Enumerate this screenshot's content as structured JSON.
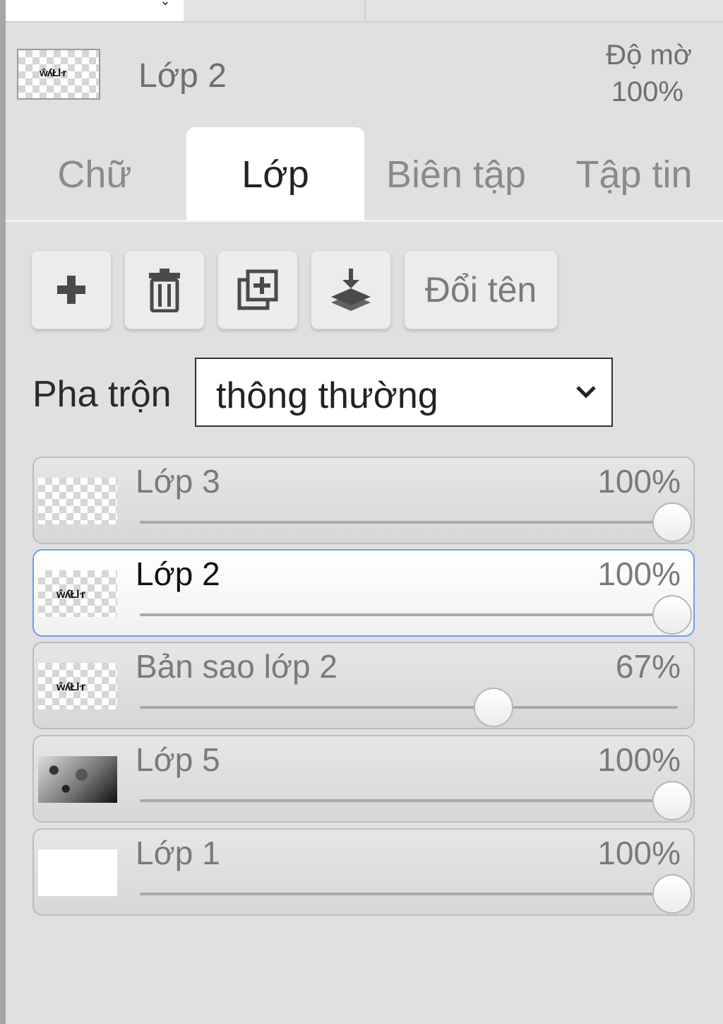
{
  "current_layer": {
    "name": "Lớp 2",
    "opacity_label": "Độ mờ",
    "opacity_value": "100%"
  },
  "tabs": [
    {
      "label": "Chữ",
      "active": false
    },
    {
      "label": "Lớp",
      "active": true
    },
    {
      "label": "Biên tập",
      "active": false
    },
    {
      "label": "Tập tin",
      "active": false
    }
  ],
  "toolbar": {
    "add_icon": "plus-icon",
    "delete_icon": "trash-icon",
    "duplicate_icon": "duplicate-icon",
    "merge_icon": "merge-down-icon",
    "rename_label": "Đổi tên"
  },
  "blend": {
    "label": "Pha trộn",
    "value": "thông thường"
  },
  "layers": [
    {
      "name": "Lớp 3",
      "opacity": "100%",
      "opacity_fraction": 1.0,
      "selected": false,
      "thumb": "transparent"
    },
    {
      "name": "Lớp 2",
      "opacity": "100%",
      "opacity_fraction": 1.0,
      "selected": true,
      "thumb": "scribble"
    },
    {
      "name": "Bản sao lớp 2",
      "opacity": "67%",
      "opacity_fraction": 0.67,
      "selected": false,
      "thumb": "scribble"
    },
    {
      "name": "Lớp 5",
      "opacity": "100%",
      "opacity_fraction": 1.0,
      "selected": false,
      "thumb": "photo"
    },
    {
      "name": "Lớp 1",
      "opacity": "100%",
      "opacity_fraction": 1.0,
      "selected": false,
      "thumb": "white"
    }
  ],
  "colors": {
    "selected_border": "#6f9df0",
    "panel_background": "#e0e0e0"
  }
}
